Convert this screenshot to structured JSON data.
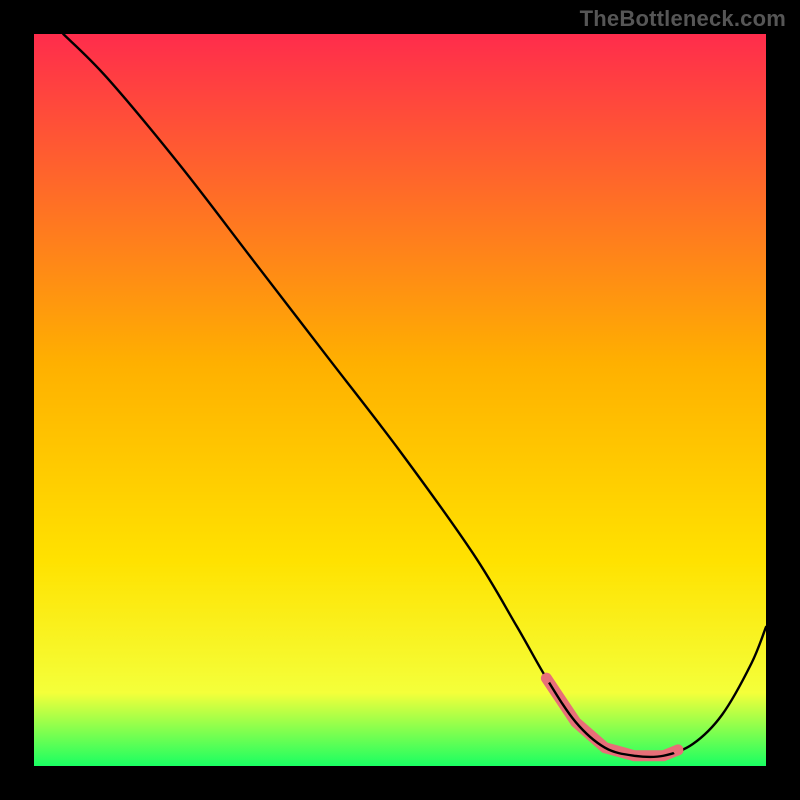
{
  "watermark": "TheBottleneck.com",
  "chart_data": {
    "type": "line",
    "title": "",
    "xlabel": "",
    "ylabel": "",
    "xlim": [
      0,
      100
    ],
    "ylim": [
      0,
      100
    ],
    "grid": false,
    "legend": false,
    "series": [
      {
        "name": "curve",
        "x": [
          4,
          10,
          20,
          30,
          40,
          50,
          60,
          66,
          70,
          74,
          78,
          82,
          86,
          90,
          94,
          98,
          100
        ],
        "y": [
          100,
          94,
          82,
          69,
          56,
          43,
          29,
          19,
          12,
          6,
          2.5,
          1.4,
          1.4,
          3,
          7,
          14,
          19
        ],
        "color": "#000000"
      }
    ],
    "background_gradient": {
      "top": "#ff2c4c",
      "mid": "#ffd400",
      "bottom": "#19ff62"
    },
    "flat_segment": {
      "x_range": [
        70,
        88
      ],
      "y": 1.6,
      "color": "#e86f78",
      "note": "thick pink band along curve trough"
    }
  }
}
